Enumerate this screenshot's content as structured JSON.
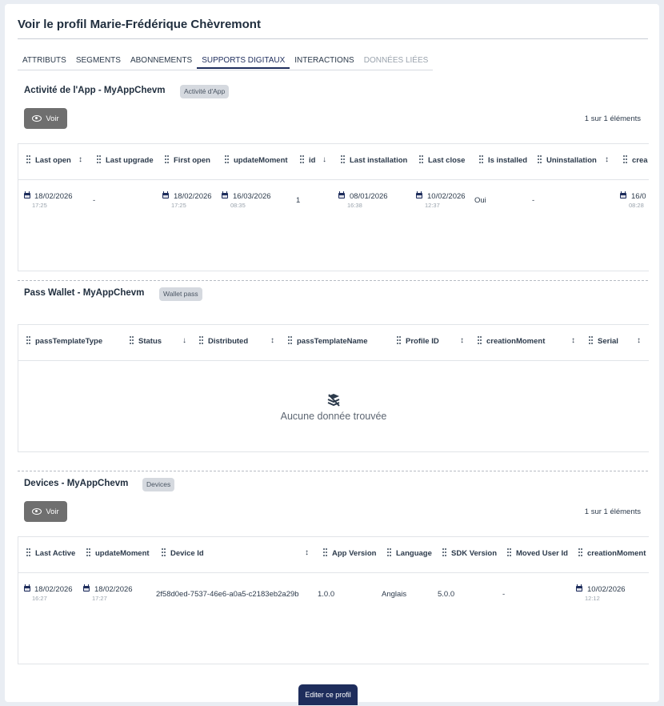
{
  "page": {
    "title": "Voir le profil Marie-Frédérique Chèvremont"
  },
  "tabs": [
    "ATTRIBUTS",
    "SEGMENTS",
    "ABONNEMENTS",
    "SUPPORTS DIGITAUX",
    "INTERACTIONS",
    "DONNÉES LIÉES"
  ],
  "active_tab": "SUPPORTS DIGITAUX",
  "app_activity": {
    "title": "Activité de l'App - MyAppChevm",
    "badge": "Activité d'App",
    "view_label": "Voir",
    "count": "1 sur 1 éléments",
    "columns": [
      "Last open",
      "Last upgrade",
      "First open",
      "updateMoment",
      "id",
      "Last installation",
      "Last close",
      "Is installed",
      "Uninstallation",
      "crea"
    ],
    "row": {
      "last_open_date": "18/02/2026",
      "last_open_time": "17:25",
      "last_upgrade": "-",
      "first_open_date": "18/02/2026",
      "first_open_time": "17:25",
      "update_date": "16/03/2026",
      "update_time": "08:35",
      "id": "1",
      "last_install_date": "08/01/2026",
      "last_install_time": "16:38",
      "last_close_date": "10/02/2026",
      "last_close_time": "12:37",
      "is_installed": "Oui",
      "uninstallation": "-",
      "creation_date": "16/0",
      "creation_time": "08:28"
    }
  },
  "wallet": {
    "title": "Pass Wallet - MyAppChevm",
    "badge": "Wallet pass",
    "columns": [
      "passTemplateType",
      "Status",
      "Distributed",
      "passTemplateName",
      "Profile ID",
      "creationMoment",
      "Serial"
    ],
    "empty_text": "Aucune donnée trouvée"
  },
  "devices": {
    "title": "Devices - MyAppChevm",
    "badge": "Devices",
    "view_label": "Voir",
    "count": "1 sur 1 éléments",
    "columns": [
      "Last Active",
      "updateMoment",
      "Device Id",
      "App Version",
      "Language",
      "SDK Version",
      "Moved User Id",
      "creationMoment"
    ],
    "row": {
      "last_active_date": "18/02/2026",
      "last_active_time": "16:27",
      "update_date": "18/02/2026",
      "update_time": "17:27",
      "device_id": "2f58d0ed-7537-46e6-a0a5-c2183eb2a29b",
      "app_version": "1.0.0",
      "language": "Anglais",
      "sdk_version": "5.0.0",
      "moved_user_id": "-",
      "creation_date": "10/02/2026",
      "creation_time": "12:12"
    }
  },
  "footer": {
    "edit_label": "Editer ce profil"
  }
}
